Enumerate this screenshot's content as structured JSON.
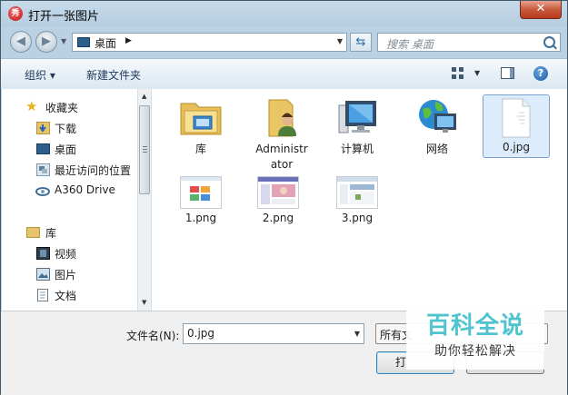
{
  "window": {
    "title": "打开一张图片",
    "app_icon_glyph": "秀",
    "close_glyph": "✕"
  },
  "address": {
    "current": "桌面",
    "separator": "▶",
    "search_placeholder": "搜索 桌面"
  },
  "toolbar": {
    "organize": "组织 ▾",
    "new_folder": "新建文件夹",
    "help": "?"
  },
  "nav": {
    "items": [
      {
        "label": "收藏夹",
        "icon": "star-icon"
      },
      {
        "label": "下载",
        "icon": "download-folder-icon"
      },
      {
        "label": "桌面",
        "icon": "desktop-icon"
      },
      {
        "label": "最近访问的位置",
        "icon": "recent-places-icon"
      },
      {
        "label": "A360 Drive",
        "icon": "cloud-drive-icon"
      },
      {
        "label": "库",
        "icon": "library-icon"
      },
      {
        "label": "视频",
        "icon": "video-icon"
      },
      {
        "label": "图片",
        "icon": "pictures-icon"
      },
      {
        "label": "文档",
        "icon": "documents-icon"
      }
    ]
  },
  "files": [
    {
      "name": "库",
      "icon": "library-folder-icon"
    },
    {
      "name": "Administrator",
      "icon": "user-folder-icon"
    },
    {
      "name": "计算机",
      "icon": "computer-icon"
    },
    {
      "name": "网络",
      "icon": "network-icon"
    },
    {
      "name": "0.jpg",
      "icon": "image-file-icon",
      "selected": true
    },
    {
      "name": "1.png",
      "icon": "image-thumbnail-icon"
    },
    {
      "name": "2.png",
      "icon": "image-thumbnail-icon"
    },
    {
      "name": "3.png",
      "icon": "image-thumbnail-icon"
    }
  ],
  "footer": {
    "filename_label": "文件名(N):",
    "filename_value": "0.jpg",
    "filetype_value": "所有文",
    "open_label": "打",
    "cancel_label": ""
  },
  "watermark": {
    "title": "百科全说",
    "subtitle": "助你轻松解决"
  },
  "colors": {
    "titlebar": "#c7dbea",
    "selection": "#dcecfc",
    "accent": "#4fc4cf"
  }
}
